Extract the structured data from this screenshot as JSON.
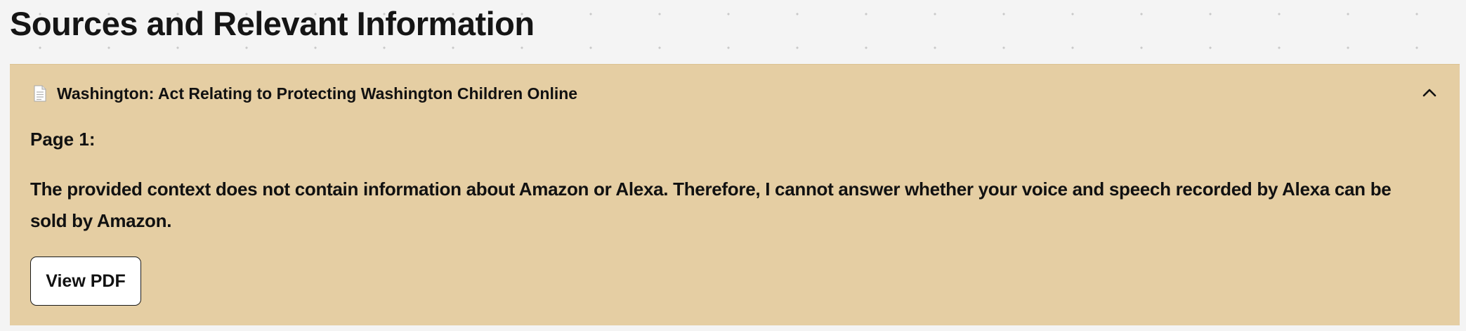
{
  "page": {
    "title": "Sources and Relevant Information"
  },
  "source": {
    "icon": "document-icon",
    "title": "Washington: Act Relating to Protecting Washington Children Online",
    "toggle_icon": "chevron-up-icon",
    "expanded": true,
    "page_label": "Page 1:",
    "answer": "The provided context does not contain information about Amazon or Alexa. Therefore, I cannot answer whether your voice and speech recorded by Alexa can be sold by Amazon.",
    "view_pdf_label": "View PDF"
  },
  "colors": {
    "page_background": "#f4f4f4",
    "panel_background": "#e5cea3",
    "text": "#111111",
    "button_background": "#ffffff"
  }
}
